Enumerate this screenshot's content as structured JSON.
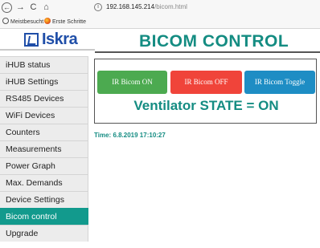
{
  "browser": {
    "nav_back": "←",
    "nav_forward": "→",
    "nav_reload": "C",
    "nav_home": "⌂",
    "info_icon": "i",
    "url_host": "192.168.145.214",
    "url_path": "/bicom.html",
    "bookmarks": [
      {
        "label": "Meistbesucht",
        "icon": "gear-icon"
      },
      {
        "label": "Erste Schritte",
        "icon": "firefox-icon"
      }
    ]
  },
  "logo": {
    "text": "Iskra",
    "color": "#1f4ea8"
  },
  "page_title": "BICOM CONTROL",
  "sidebar": {
    "items": [
      {
        "label": "iHUB status",
        "active": false
      },
      {
        "label": "iHUB Settings",
        "active": false
      },
      {
        "label": "RS485 Devices",
        "active": false
      },
      {
        "label": "WiFi Devices",
        "active": false
      },
      {
        "label": "Counters",
        "active": false
      },
      {
        "label": "Measurements",
        "active": false
      },
      {
        "label": "Power Graph",
        "active": false
      },
      {
        "label": "Max. Demands",
        "active": false
      },
      {
        "label": "Device Settings",
        "active": false
      },
      {
        "label": "Bicom control",
        "active": true
      },
      {
        "label": "Upgrade",
        "active": false
      }
    ]
  },
  "controls": {
    "btn_on": "IR Bicom ON",
    "btn_off": "IR Bicom OFF",
    "btn_toggle": "IR Bicom Toggle",
    "state": "Ventilator STATE = ON"
  },
  "time": {
    "label": "Time:",
    "value": "6.8.2019 17:10:27"
  },
  "colors": {
    "accent": "#148c82",
    "on": "#4caa50",
    "off": "#f0443a",
    "toggle": "#1e8dc4",
    "active_nav": "#129a8d"
  }
}
